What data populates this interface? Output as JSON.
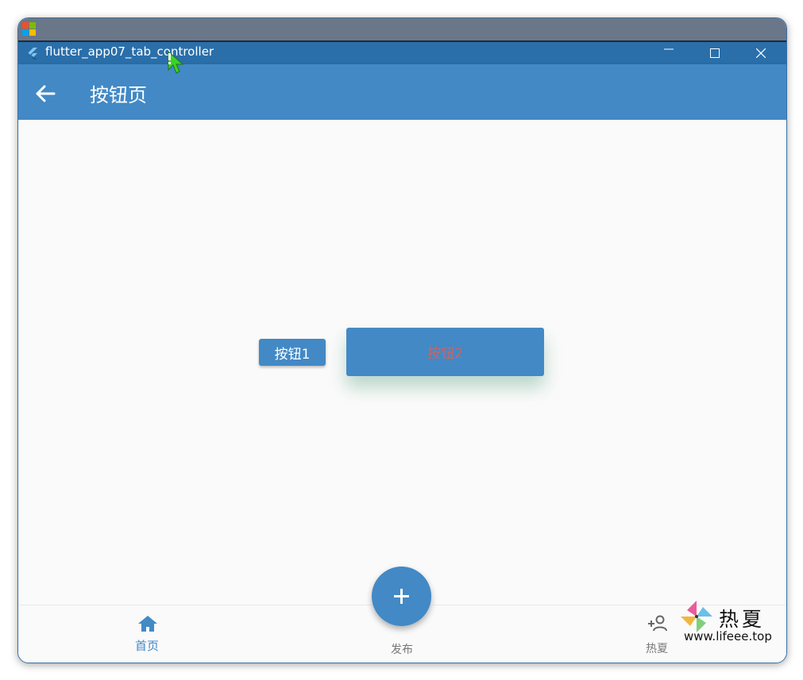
{
  "window": {
    "title": "flutter_app07_tab_controller"
  },
  "appbar": {
    "title": "按钮页",
    "back_icon": "arrow-left-icon"
  },
  "buttons": {
    "button1_label": "按钮1",
    "button2_label": "按钮2"
  },
  "bottom_nav": {
    "items": [
      {
        "label": "首页",
        "icon": "home-icon",
        "selected": true
      },
      {
        "label": "发布",
        "icon": "add-icon",
        "selected": false
      },
      {
        "label": "热夏",
        "icon": "person-add-icon",
        "selected": false
      }
    ],
    "fab_icon": "plus-icon"
  },
  "watermark": {
    "name": "热夏",
    "url": "www.lifeee.top"
  },
  "colors": {
    "primary": "#4289c6",
    "titlebar": "#2a6faa",
    "button2_text": "#c96565",
    "nav_selected": "#4289c6",
    "nav_unselected": "#777777"
  }
}
